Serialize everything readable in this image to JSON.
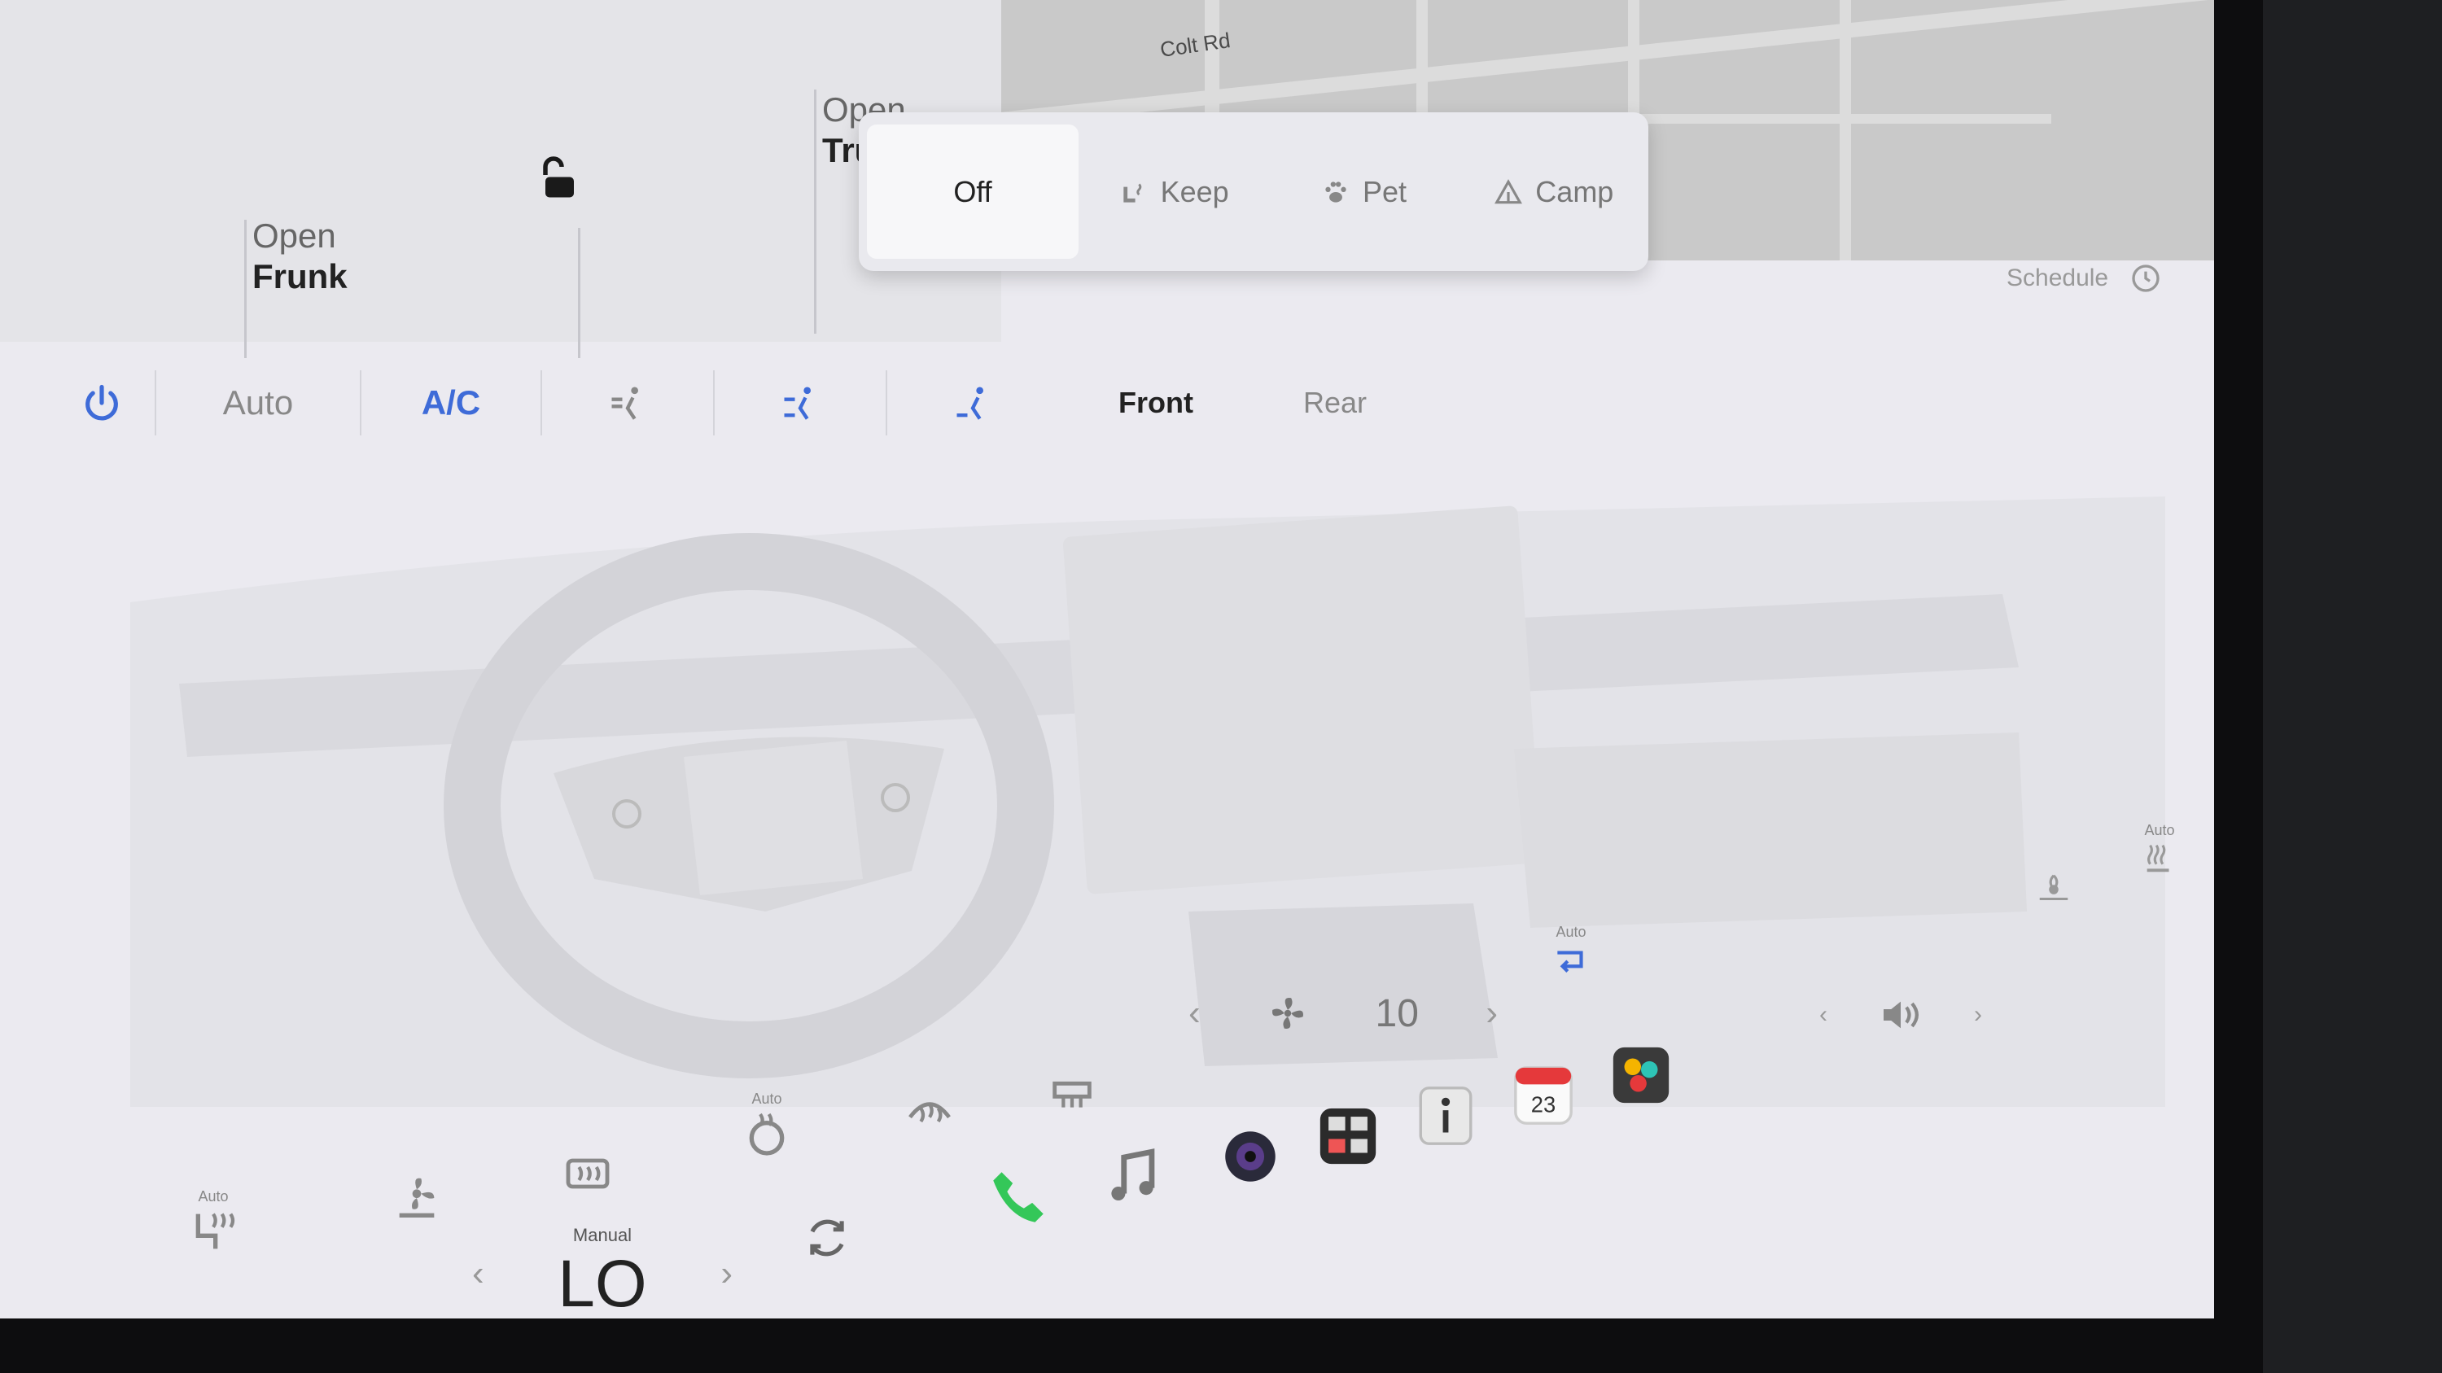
{
  "map": {
    "street_label": "Colt Rd"
  },
  "controls": {
    "frunk": {
      "line1": "Open",
      "line2": "Frunk"
    },
    "trunk": {
      "line1": "Open",
      "line2": "Trunk"
    },
    "lock_icon": "unlock-icon"
  },
  "climate_mode": {
    "selected": "Off",
    "options": [
      {
        "label": "Off",
        "icon": "none"
      },
      {
        "label": "Keep",
        "icon": "keep-climate-icon"
      },
      {
        "label": "Pet",
        "icon": "paw-icon"
      },
      {
        "label": "Camp",
        "icon": "tent-icon"
      }
    ]
  },
  "schedule": {
    "label": "Schedule",
    "icon": "clock-icon"
  },
  "climate_bar": {
    "power_icon": "power-icon",
    "auto_label": "Auto",
    "ac_label": "A/C",
    "airflow_icons": [
      "airflow-face-icon",
      "airflow-face-feet-icon",
      "airflow-feet-icon"
    ],
    "zone_front": "Front",
    "zone_rear": "Rear",
    "active_color": "#3e6bd8"
  },
  "fan": {
    "speed": "10",
    "icon": "fan-icon"
  },
  "recirculation": {
    "mode_label": "Auto",
    "icon": "recirculate-icon"
  },
  "seats": {
    "driver_heat": {
      "mode_label": "Auto",
      "icon": "seat-heat-icon"
    },
    "driver_fan_icon": "seat-fan-icon",
    "rear_defrost_icon": "rear-defrost-icon",
    "steering_heat": {
      "mode_label": "Auto",
      "icon": "steering-heat-icon"
    },
    "front_defrost_icon": "front-defrost-icon",
    "wiper_defrost_icon": "wiper-heat-icon"
  },
  "passenger": {
    "seat_heat": {
      "mode_label": "Auto",
      "icon": "seat-heat-icon"
    },
    "seat_fan_icon": "seat-fan-icon"
  },
  "temperature": {
    "mode_label": "Manual",
    "value": "LO"
  },
  "dock": {
    "apps": [
      {
        "name": "phone-app-icon",
        "color": "#34c759"
      },
      {
        "name": "music-app-icon",
        "color": "#777777"
      },
      {
        "name": "camera-app-icon",
        "color": "#1f1f2e"
      },
      {
        "name": "controls-app-icon",
        "color": "#2b2b2b"
      },
      {
        "name": "manual-app-icon",
        "color": "#e8e8e8"
      },
      {
        "name": "calendar-app-icon",
        "date": "23"
      },
      {
        "name": "toybox-app-icon",
        "color": "#3a3a3a"
      }
    ]
  },
  "volume_icon": "volume-icon"
}
